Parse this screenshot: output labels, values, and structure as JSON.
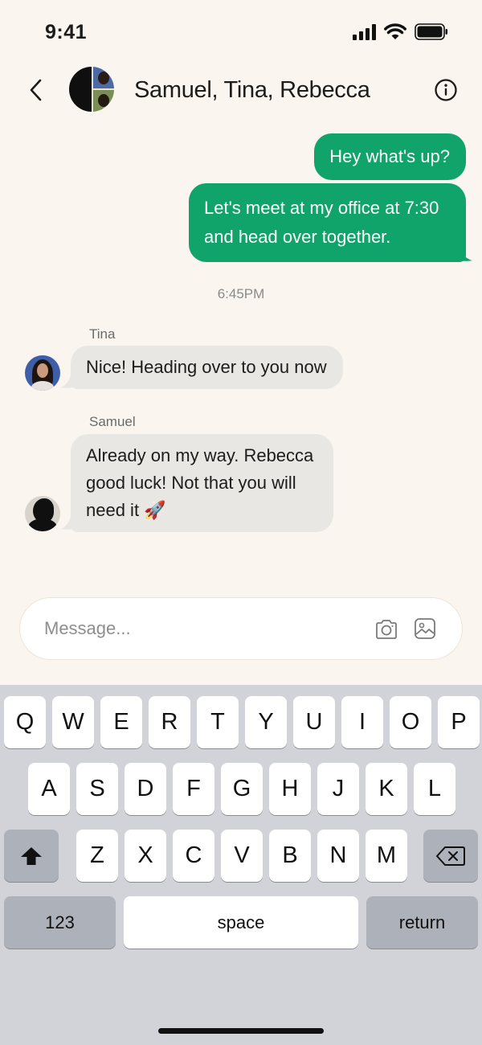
{
  "status_bar": {
    "time": "9:41"
  },
  "header": {
    "title": "Samuel, Tina, Rebecca"
  },
  "messages": {
    "m1": "Hey what's up?",
    "m2": "Let's meet at my office at 7:30 and head over together.",
    "timestamp": "6:45PM",
    "tina_name": "Tina",
    "m3": "Nice! Heading over to you now",
    "samuel_name": "Samuel",
    "m4": "Already on my way. Rebecca good luck! Not that you will need it 🚀"
  },
  "composer": {
    "placeholder": "Message..."
  },
  "keyboard": {
    "row1": [
      "Q",
      "W",
      "E",
      "R",
      "T",
      "Y",
      "U",
      "I",
      "O",
      "P"
    ],
    "row2": [
      "A",
      "S",
      "D",
      "F",
      "G",
      "H",
      "J",
      "K",
      "L"
    ],
    "row3": [
      "Z",
      "X",
      "C",
      "V",
      "B",
      "N",
      "M"
    ],
    "numbers_label": "123",
    "space_label": "space",
    "return_label": "return"
  },
  "colors": {
    "outgoing_bubble": "#10a36a",
    "incoming_bubble": "#e8e7e4",
    "background": "#faf6ef",
    "keyboard": "#d1d3d9"
  }
}
